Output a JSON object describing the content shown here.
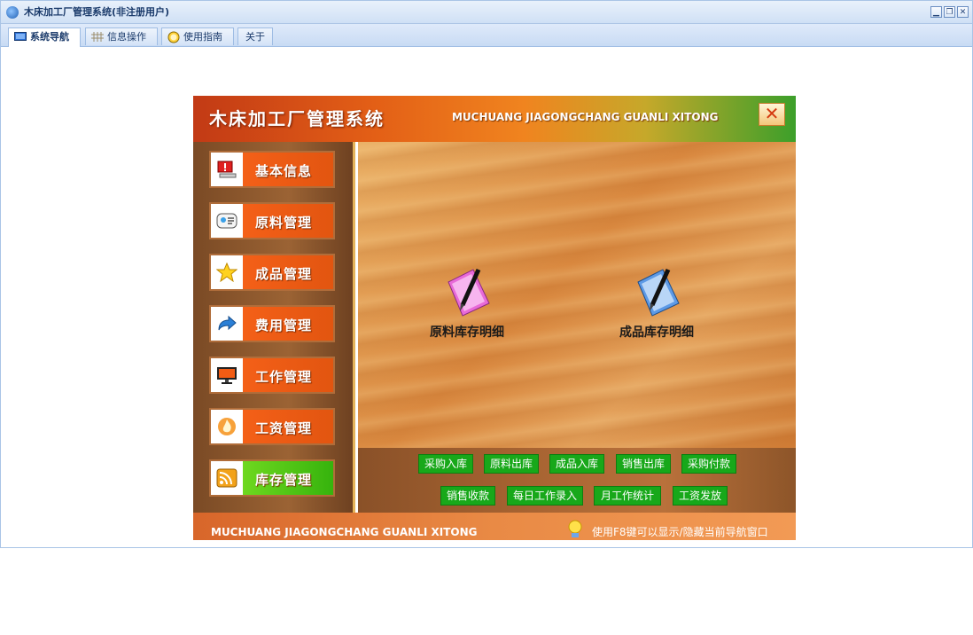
{
  "window": {
    "title": "木床加工厂管理系统(非注册用户)",
    "controls": [
      "minimize",
      "restore",
      "close"
    ]
  },
  "tabs": [
    {
      "label": "系统导航",
      "icon": "monitor-icon",
      "active": true
    },
    {
      "label": "信息操作",
      "icon": "grid-icon",
      "active": false
    },
    {
      "label": "使用指南",
      "icon": "clock-icon",
      "active": false
    },
    {
      "label": "关于",
      "icon": "",
      "active": false
    }
  ],
  "panel": {
    "title": "木床加工厂管理系统",
    "subtitle": "MUCHUANG JIAGONGCHANG GUANLI XITONG",
    "close_label": "✕",
    "nav": [
      {
        "label": "基本信息",
        "icon": "alert-computer-icon",
        "color": "#f25c14"
      },
      {
        "label": "原料管理",
        "icon": "contact-card-icon",
        "color": "#f25c14"
      },
      {
        "label": "成品管理",
        "icon": "star-icon",
        "color": "#f25c14"
      },
      {
        "label": "费用管理",
        "icon": "arrow-forward-icon",
        "color": "#f25c14"
      },
      {
        "label": "工作管理",
        "icon": "monitor-icon",
        "color": "#f25c14"
      },
      {
        "label": "工资管理",
        "icon": "fire-icon",
        "color": "#f25c14"
      },
      {
        "label": "库存管理",
        "icon": "rss-icon",
        "color": "#3fbf16",
        "active": true
      }
    ],
    "features": [
      {
        "label": "原料库存明细",
        "icon": "pen-paper-pink-icon"
      },
      {
        "label": "成品库存明细",
        "icon": "pen-paper-blue-icon"
      }
    ],
    "quick_row1": [
      "采购入库",
      "原料出库",
      "成品入库",
      "销售出库",
      "采购付款"
    ],
    "quick_row2": [
      "销售收款",
      "每日工作录入",
      "月工作统计",
      "工资发放"
    ],
    "footer_subtitle": "MUCHUANG JIAGONGCHANG GUANLI XITONG",
    "footer_tip": "使用F8键可以显示/隐藏当前导航窗口",
    "tip_icon": "lightbulb-icon"
  }
}
